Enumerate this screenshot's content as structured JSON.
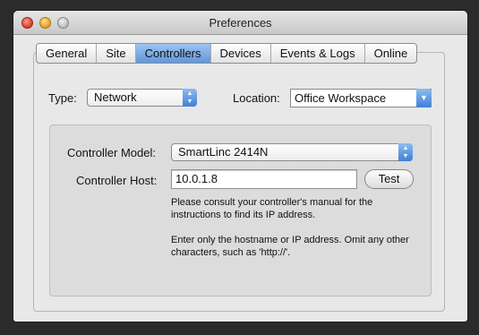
{
  "window": {
    "title": "Preferences"
  },
  "tabs": [
    {
      "label": "General",
      "active": false
    },
    {
      "label": "Site",
      "active": false
    },
    {
      "label": "Controllers",
      "active": true
    },
    {
      "label": "Devices",
      "active": false
    },
    {
      "label": "Events & Logs",
      "active": false
    },
    {
      "label": "Online",
      "active": false
    }
  ],
  "type": {
    "label": "Type:",
    "value": "Network"
  },
  "location": {
    "label": "Location:",
    "value": "Office Workspace"
  },
  "controller": {
    "model_label": "Controller Model:",
    "model_value": "SmartLinc 2414N",
    "host_label": "Controller Host:",
    "host_value": "10.0.1.8",
    "test_label": "Test",
    "help_1": "Please consult your controller's manual for the instructions to find its IP address.",
    "help_2": "Enter only the hostname or IP address. Omit any other characters, such as 'http://'."
  },
  "icons": {
    "popup_stepper": "up-down-arrows-icon",
    "combo_arrow": "chevron-down-icon"
  },
  "colors": {
    "accent": "#5f97dc",
    "window_bg": "#e8e8e8",
    "desktop": "#2b2b2b"
  }
}
